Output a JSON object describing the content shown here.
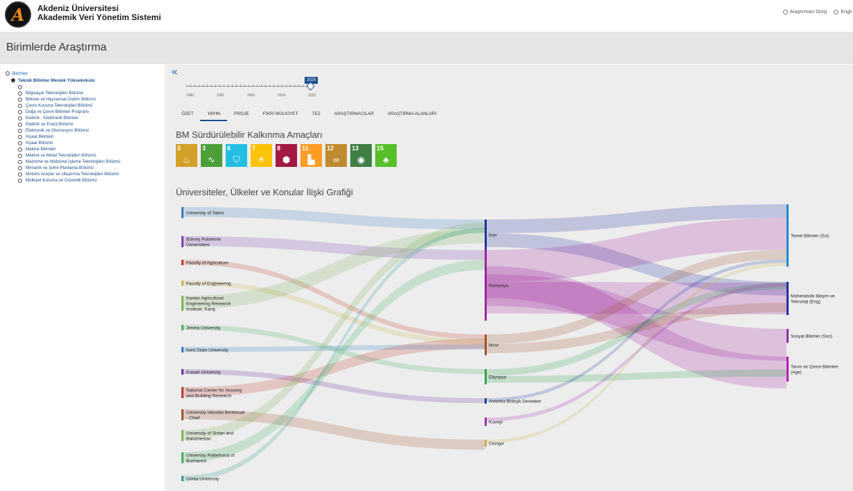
{
  "header": {
    "brand_line1": "Akdeniz Üniversitesi",
    "brand_line2": "Akademik Veri Yönetim Sistemi",
    "login_label": "Araştırmacı Girişi",
    "lang_label": "Engli"
  },
  "page_title": "Birimlerde Araştırma",
  "sidebar": {
    "root_label": "Birimler",
    "unit_label": "Teknik Bilimler Meslek Yüksekokulu",
    "items": [
      "-",
      "Bilgisayar Teknolojileri Bölümü",
      "Bitkisel ve Hayvansal Üretim Bölümü",
      "Çevre Koruma Teknolojileri Bölümü",
      "Doğa ve Çevre Bilimleri Programı",
      "Elektrik - Elektronik Bilimleri",
      "Elektrik ve Enerji Bölümü",
      "Elektronik ve Otomasyon Bölümü",
      "İnşaat Bilimleri",
      "İnşaat Bölümü",
      "Makine Bilimleri",
      "Makine ve Metal Teknolojileri Bölümü",
      "Malzeme ve Malzeme İşleme Teknolojileri Bölümü",
      "Mimarlık ve Şehir Planlama Bölümü",
      "Motorlu Araçlar ve Ulaştırma Teknolojileri Bölümü",
      "Mülkiyet Koruma ve Güvenlik Bölümü"
    ]
  },
  "collapse_glyph": "«",
  "timeline": {
    "selected_year": "2025",
    "ticks": [
      "1980",
      "1991",
      "2003",
      "2014",
      "2025"
    ]
  },
  "tabs": [
    "ÖZET",
    "YAYIN",
    "PROJE",
    "FİKRİ MÜLKİYET",
    "TEZ",
    "ARAŞTIRMACILAR",
    "ARAŞTIRMA ALANLARI"
  ],
  "active_tab": "YAYIN",
  "sdg_title": "BM Sürdürülebilir Kalkınma Amaçları",
  "sdgs": [
    {
      "num": "2",
      "color": "#d3a029",
      "icon": "♨"
    },
    {
      "num": "3",
      "color": "#4c9f38",
      "icon": "∿"
    },
    {
      "num": "6",
      "color": "#26bde2",
      "icon": "⛉"
    },
    {
      "num": "7",
      "color": "#fcc30b",
      "icon": "☀"
    },
    {
      "num": "8",
      "color": "#a21942",
      "icon": "⬢"
    },
    {
      "num": "11",
      "color": "#fd9d24",
      "icon": "▙"
    },
    {
      "num": "12",
      "color": "#bf8b2e",
      "icon": "∞"
    },
    {
      "num": "13",
      "color": "#3f7e44",
      "icon": "◉"
    },
    {
      "num": "15",
      "color": "#56c02b",
      "icon": "♣"
    }
  ],
  "sankey_title": "Üniversiteler, Ülkeler ve Konular İlişki Grafiği",
  "sankey": {
    "left_nodes": [
      {
        "label": "University of Tabriz",
        "color": "#3b7bbf"
      },
      {
        "label": "Bükreş Politeknik Üniversitesi",
        "color": "#7a3fb0"
      },
      {
        "label": "Faculty of Agriculture",
        "color": "#c0392b"
      },
      {
        "label": "Faculty of Engineering",
        "color": "#c9b44a"
      },
      {
        "label": "Iranian Agricultural Engineering Research Institute, Karaj",
        "color": "#7db35a"
      },
      {
        "label": "Jimma University",
        "color": "#3fae5a"
      },
      {
        "label": "Kent State University",
        "color": "#2e7fc4"
      },
      {
        "label": "Kuwait University",
        "color": "#6a2fa0"
      },
      {
        "label": "National Center for Housing and Building Research",
        "color": "#c0392b"
      },
      {
        "label": "University Hassiba Benbouali - Chlef",
        "color": "#a0522d"
      },
      {
        "label": "University of Sistan and Baluchestan",
        "color": "#7ab35a"
      },
      {
        "label": "University Politehnica of Bucharest",
        "color": "#3fae5a"
      },
      {
        "label": "Urmia University",
        "color": "#2a9d8f"
      }
    ],
    "mid_nodes": [
      {
        "label": "İran",
        "color": "#1f2fa0"
      },
      {
        "label": "Romanya",
        "color": "#a020a0"
      },
      {
        "label": "Mısır",
        "color": "#a0522d"
      },
      {
        "label": "Etiyopya",
        "color": "#2ea44f"
      },
      {
        "label": "Amerika Birleşik Devletleri",
        "color": "#1a3fa0"
      },
      {
        "label": "Kuveyt",
        "color": "#9b2fb0"
      },
      {
        "label": "Cezayir",
        "color": "#c9b44a"
      }
    ],
    "right_nodes": [
      {
        "label": "Temel Bilimler (Sci)",
        "color": "#1e88c8"
      },
      {
        "label": "Mühendislik Bilişim ve Teknoloji (Eng)",
        "color": "#1f2fa0"
      },
      {
        "label": "Sosyal Bilimler (Soc)",
        "color": "#8a2fb0"
      },
      {
        "label": "Tarım ve Çevre Bilimleri (Age)",
        "color": "#b020b0"
      }
    ]
  }
}
